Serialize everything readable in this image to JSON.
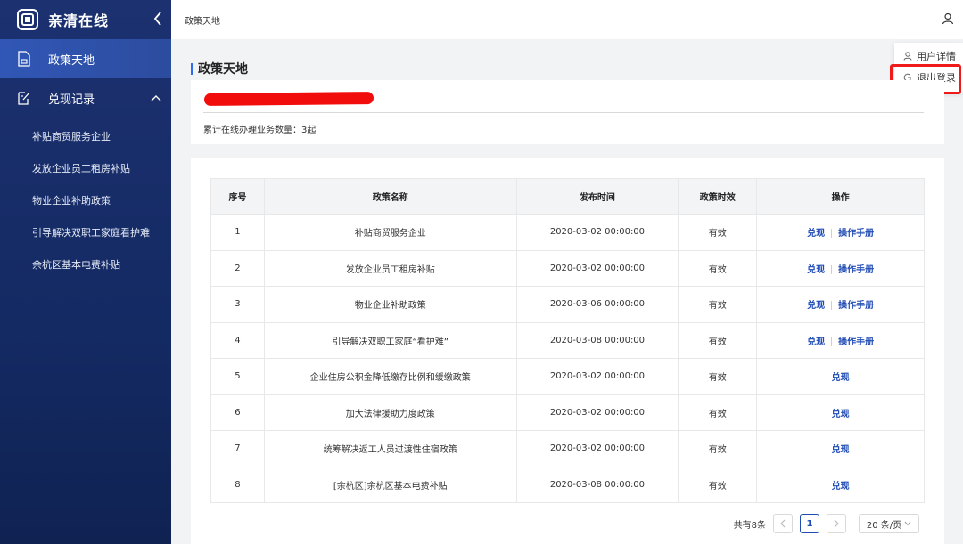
{
  "app": {
    "name": "亲清在线"
  },
  "sidebar": {
    "items": [
      {
        "label": "政策天地"
      },
      {
        "label": "兑现记录"
      }
    ],
    "sub_items": [
      {
        "label": "补贴商贸服务企业"
      },
      {
        "label": "发放企业员工租房补贴"
      },
      {
        "label": "物业企业补助政策"
      },
      {
        "label": "引导解决双职工家庭看护难"
      },
      {
        "label": "余杭区基本电费补贴"
      }
    ]
  },
  "topbar": {
    "breadcrumb": "政策天地"
  },
  "user_menu": {
    "details": "用户详情",
    "logout": "退出登录"
  },
  "page": {
    "title": "政策天地",
    "count_text": "累计在线办理业务数量：3起"
  },
  "table": {
    "headers": [
      "序号",
      "政策名称",
      "发布时间",
      "政策时效",
      "操作"
    ],
    "rows": [
      {
        "no": "1",
        "name": "补贴商贸服务企业",
        "time": "2020-03-02 00:00:00",
        "status": "有效",
        "redeem": "兑现",
        "manual": "操作手册"
      },
      {
        "no": "2",
        "name": "发放企业员工租房补贴",
        "time": "2020-03-02 00:00:00",
        "status": "有效",
        "redeem": "兑现",
        "manual": "操作手册"
      },
      {
        "no": "3",
        "name": "物业企业补助政策",
        "time": "2020-03-06 00:00:00",
        "status": "有效",
        "redeem": "兑现",
        "manual": "操作手册"
      },
      {
        "no": "4",
        "name": "引导解决双职工家庭“看护难”",
        "time": "2020-03-08 00:00:00",
        "status": "有效",
        "redeem": "兑现",
        "manual": "操作手册"
      },
      {
        "no": "5",
        "name": "企业住房公积金降低缴存比例和缓缴政策",
        "time": "2020-03-02 00:00:00",
        "status": "有效",
        "redeem": "兑现"
      },
      {
        "no": "6",
        "name": "加大法律援助力度政策",
        "time": "2020-03-02 00:00:00",
        "status": "有效",
        "redeem": "兑现"
      },
      {
        "no": "7",
        "name": "统筹解决返工人员过渡性住宿政策",
        "time": "2020-03-02 00:00:00",
        "status": "有效",
        "redeem": "兑现"
      },
      {
        "no": "8",
        "name": "[余杭区]余杭区基本电费补贴",
        "time": "2020-03-08 00:00:00",
        "status": "有效",
        "redeem": "兑现"
      }
    ]
  },
  "pager": {
    "total": "共有8条",
    "current": "1",
    "page_size": "20 条/页"
  }
}
